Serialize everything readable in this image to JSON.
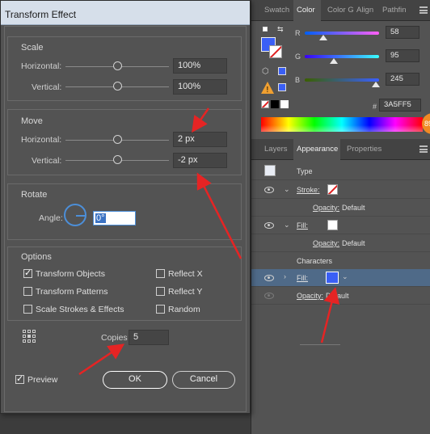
{
  "dialog": {
    "title": "Transform Effect",
    "scale": {
      "label": "Scale",
      "horizontal_label": "Horizontal:",
      "horizontal_value": "100%",
      "vertical_label": "Vertical:",
      "vertical_value": "100%"
    },
    "move": {
      "label": "Move",
      "horizontal_label": "Horizontal:",
      "horizontal_value": "2 px",
      "vertical_label": "Vertical:",
      "vertical_value": "-2 px"
    },
    "rotate": {
      "label": "Rotate",
      "angle_label": "Angle:",
      "angle_value": "0°"
    },
    "options": {
      "label": "Options",
      "transform_objects": "Transform Objects",
      "transform_patterns": "Transform Patterns",
      "scale_strokes": "Scale Strokes & Effects",
      "reflect_x": "Reflect X",
      "reflect_y": "Reflect Y",
      "random": "Random",
      "checked": {
        "transform_objects": true,
        "transform_patterns": false,
        "scale_strokes": false,
        "reflect_x": false,
        "reflect_y": false,
        "random": false
      }
    },
    "copies_label": "Copies",
    "copies_value": "5",
    "preview_label": "Preview",
    "preview_checked": true,
    "ok_label": "OK",
    "cancel_label": "Cancel"
  },
  "color_panel": {
    "tabs": [
      "Swatch",
      "Color",
      "Color G",
      "Align",
      "Pathfin"
    ],
    "active_tab": "Color",
    "r_label": "R",
    "r_value": "58",
    "g_label": "G",
    "g_value": "95",
    "b_label": "B",
    "b_value": "245",
    "hex_label": "#",
    "hex_value": "3A5FF5",
    "badge_text": "89",
    "fill_color": "#3a5ff5"
  },
  "appearance_panel": {
    "tabs": [
      "Layers",
      "Appearance",
      "Properties"
    ],
    "active_tab": "Appearance",
    "type_label": "Type",
    "stroke_label": "Stroke:",
    "opacity_label": "Opacity:",
    "opacity_value": "Default",
    "fill_label": "Fill:",
    "characters_label": "Characters"
  }
}
